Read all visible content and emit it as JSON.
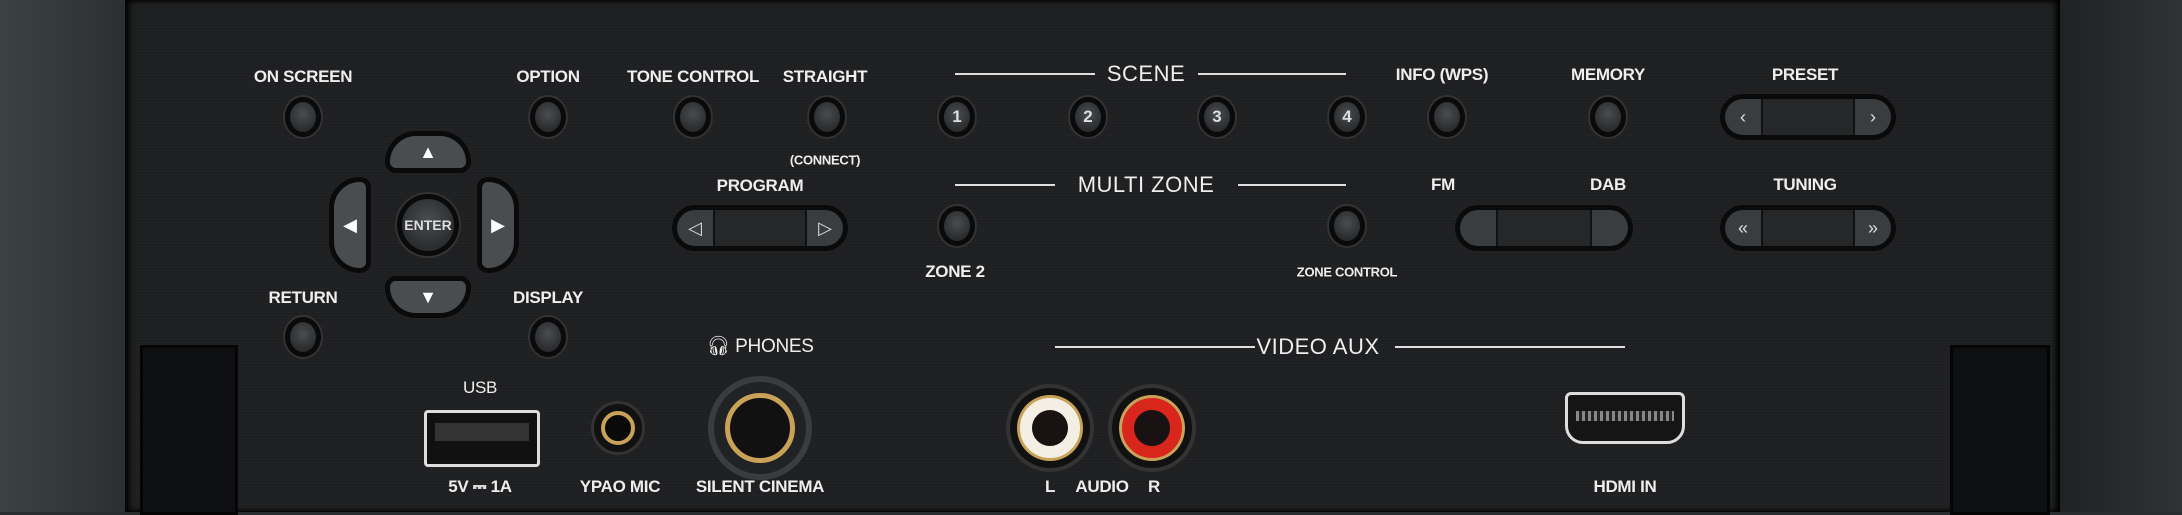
{
  "buttons": {
    "on_screen": "ON SCREEN",
    "option": "OPTION",
    "tone_control": "TONE CONTROL",
    "straight": "STRAIGHT",
    "connect": "(CONNECT)",
    "return": "RETURN",
    "display": "DISPLAY",
    "enter": "ENTER",
    "info": "INFO (WPS)",
    "memory": "MEMORY",
    "zone2": "ZONE 2",
    "zone_control": "ZONE CONTROL"
  },
  "scene": {
    "title": "SCENE",
    "items": [
      "1",
      "2",
      "3",
      "4"
    ]
  },
  "multi_zone": {
    "title": "MULTI ZONE"
  },
  "program": {
    "label": "PROGRAM",
    "left": "◁",
    "right": "▷"
  },
  "preset": {
    "label": "PRESET",
    "left": "‹",
    "right": "›"
  },
  "tuning": {
    "label": "TUNING",
    "left": "«",
    "right": "»"
  },
  "band": {
    "fm": "FM",
    "dab": "DAB"
  },
  "dpad": {
    "up": "▲",
    "down": "▼",
    "left": "◀",
    "right": "▶"
  },
  "front_io": {
    "phones": "PHONES",
    "usb": "USB",
    "usb_rating": "5V ⎓ 1A",
    "ypao": "YPAO MIC",
    "silent_cinema": "SILENT CINEMA",
    "video_aux": "VIDEO AUX",
    "l": "L",
    "audio": "AUDIO",
    "r": "R",
    "hdmi": "HDMI IN"
  },
  "colors": {
    "panel": "#1e1f20",
    "label": "#eeeeee",
    "gold": "#c9a25a",
    "red": "#d8261c"
  }
}
